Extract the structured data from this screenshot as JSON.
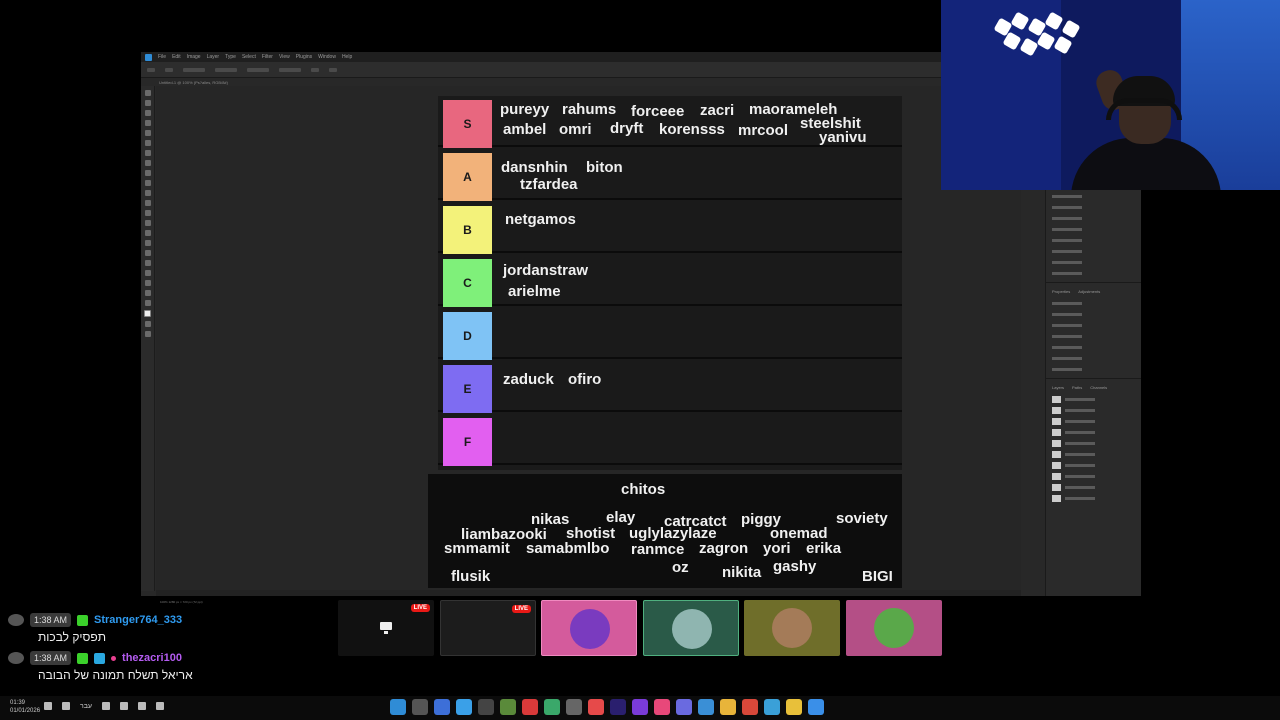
{
  "photoshop": {
    "menu_items": [
      "File",
      "Edit",
      "Image",
      "Layer",
      "Type",
      "Select",
      "Filter",
      "View",
      "Plugins",
      "Window",
      "Help"
    ],
    "doc_tab": "Untitled-1 @ 100% (Ps?alles, RGB/8#)",
    "status": "100%  1280 px × 720 px (72 ppi)",
    "panels": {
      "properties_tabs": [
        "Properties",
        "Adjustments"
      ],
      "layers_tabs": [
        "Layers",
        "Paths",
        "Channels"
      ]
    }
  },
  "tiers": [
    {
      "label": "S",
      "color": "#e8677f",
      "names": [
        "pureyy",
        "rahums",
        "forceee",
        "zacri",
        "maorameleh",
        "ambel",
        "omri",
        "dryft",
        "korensss",
        "mrcool",
        "steelshit",
        "yanivu"
      ]
    },
    {
      "label": "A",
      "color": "#f2b27a",
      "names": [
        "dansnhin",
        "biton",
        "tzfardea"
      ]
    },
    {
      "label": "B",
      "color": "#f3f27a",
      "names": [
        "netgamos"
      ]
    },
    {
      "label": "C",
      "color": "#7ff07a",
      "names": [
        "jordanstraw",
        "arielme"
      ]
    },
    {
      "label": "D",
      "color": "#7fc3f5",
      "names": []
    },
    {
      "label": "E",
      "color": "#7e6cf2",
      "names": [
        "zaduck",
        "ofiro"
      ]
    },
    {
      "label": "F",
      "color": "#e25ff0",
      "names": []
    }
  ],
  "pool": [
    "chitos",
    "nikas",
    "elay",
    "catrcatct",
    "piggy",
    "soviety",
    "liambazooki",
    "shotist",
    "uglylazylaze",
    "onemad",
    "smmamit",
    "samabmlbo",
    "ranmce",
    "zagron",
    "yori",
    "erika",
    "oz",
    "nikita",
    "gashy",
    "flusik",
    "BIGI"
  ],
  "chat": [
    {
      "time": "1:38 AM",
      "user": "Stranger764_333",
      "user_color": "#2f9bf0",
      "text": "תפסיק לבכות"
    },
    {
      "time": "1:38 AM",
      "user": "thezacri100",
      "user_color": "#b45cf0",
      "text": "אריאל תשלח תמונה של הבובה"
    }
  ],
  "tiles": [
    {
      "live": "LIVE",
      "kind": "screen"
    },
    {
      "live": "LIVE",
      "kind": "stream-preview"
    },
    {
      "kind": "avatar",
      "bg": "#d45b9c"
    },
    {
      "kind": "avatar",
      "bg": "#2a5a48"
    },
    {
      "kind": "avatar",
      "bg": "#6f6e2a"
    },
    {
      "kind": "avatar",
      "bg": "#b44f86"
    }
  ],
  "taskbar": {
    "time": "01:39",
    "date": "01/01/2026",
    "lang": "עבר"
  }
}
